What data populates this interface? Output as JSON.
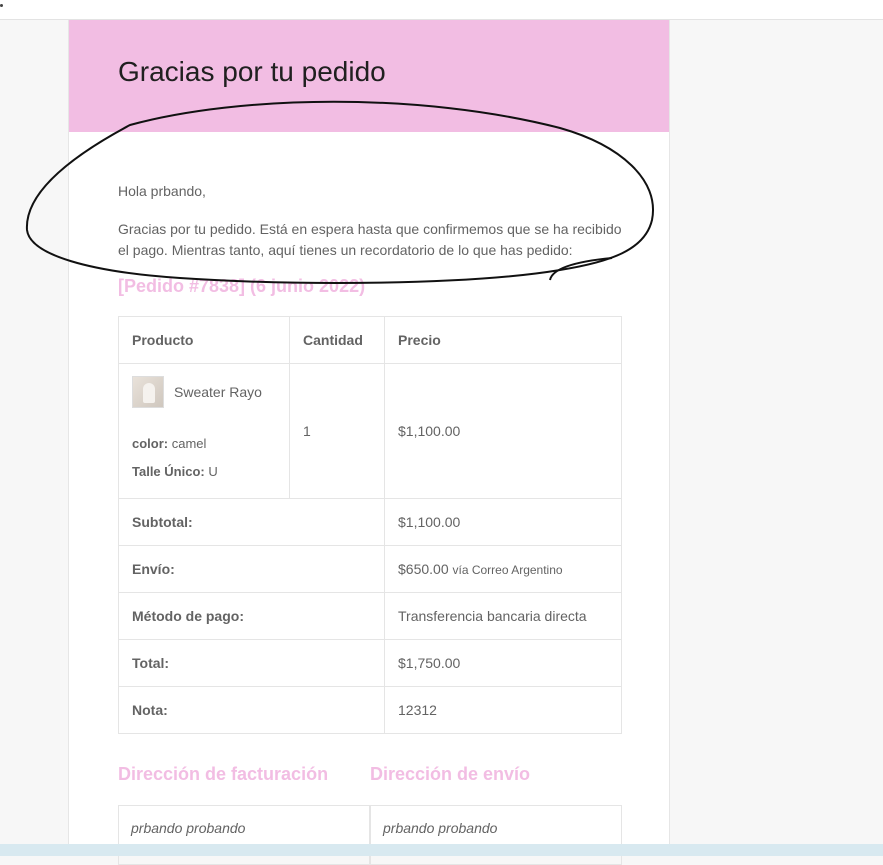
{
  "header": {
    "title": "Gracias por tu pedido"
  },
  "greeting": "Hola prbando,",
  "intro": "Gracias por tu pedido. Está en espera hasta que confirmemos que se ha recibido el pago. Mientras tanto, aquí tienes un recordatorio de lo que has pedido:",
  "order_title": "[Pedido #7838] (6 junio 2022)",
  "table": {
    "headers": [
      "Producto",
      "Cantidad",
      "Precio"
    ],
    "item": {
      "name": "Sweater Rayo",
      "color_label": "color:",
      "color_value": "camel",
      "size_label": "Talle Único:",
      "size_value": "U",
      "quantity": "1",
      "price": "$1,100.00"
    },
    "totals": [
      {
        "label": "Subtotal:",
        "value": "$1,100.00",
        "note": ""
      },
      {
        "label": "Envío:",
        "value": "$650.00",
        "note": "vía Correo Argentino"
      },
      {
        "label": "Método de pago:",
        "value": "Transferencia bancaria directa",
        "note": ""
      },
      {
        "label": "Total:",
        "value": "$1,750.00",
        "note": ""
      },
      {
        "label": "Nota:",
        "value": "12312",
        "note": ""
      }
    ]
  },
  "billing": {
    "title": "Dirección de facturación",
    "name": "prbando probando"
  },
  "shipping": {
    "title": "Dirección de envío",
    "name": "prbando probando"
  },
  "colors": {
    "accent": "#f2bde3",
    "text": "#636363",
    "heading": "#202020"
  }
}
